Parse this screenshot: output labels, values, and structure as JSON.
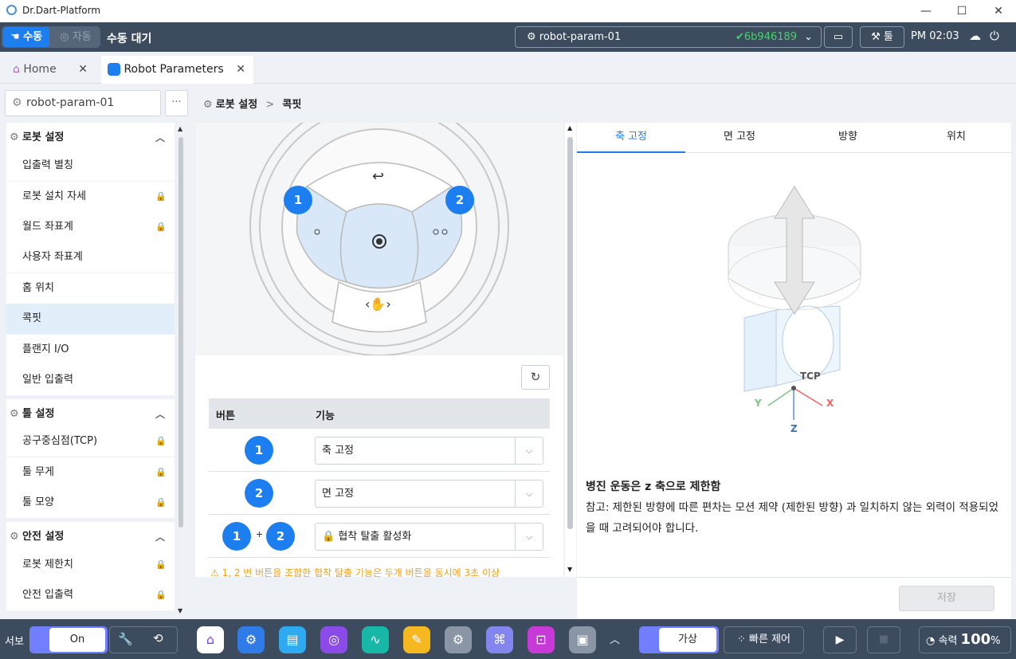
{
  "window": {
    "title": "Dr.Dart-Platform",
    "minimize": "—",
    "maximize": "☐",
    "close": "✕"
  },
  "header": {
    "mode_manual": "수동",
    "mode_auto": "자동",
    "status": "수동 대기",
    "robot_selector": "robot-param-01",
    "commit": "6b946189",
    "tool_label": "툴",
    "clock": "PM 02:03"
  },
  "tabs": [
    {
      "label": "Home",
      "close": "✕"
    },
    {
      "label": "Robot Parameters",
      "close": "✕"
    }
  ],
  "sidebar": {
    "robot_name": "robot-param-01",
    "more": "···",
    "sections": [
      {
        "title": "로봇 설정",
        "items": [
          "입출력 별칭",
          "로봇 설치 자세",
          "월드 좌표계",
          "사용자 좌표계",
          "홈 위치",
          "콕핏",
          "플랜지 I/O",
          "일반 입출력"
        ]
      },
      {
        "title": "툴 설정",
        "items": [
          "공구중심점(TCP)",
          "툴 무게",
          "툴 모양"
        ]
      },
      {
        "title": "안전 설정",
        "items": [
          "로봇 제한치",
          "안전 입출력"
        ]
      }
    ]
  },
  "breadcrumb": {
    "parent": "로봇 설정",
    "sep": ">",
    "current": "콕핏"
  },
  "table": {
    "col_button": "버튼",
    "col_function": "기능",
    "rows": [
      {
        "b1": "1",
        "value": "축 고정"
      },
      {
        "b1": "2",
        "value": "면 고정"
      },
      {
        "b1": "1",
        "plus": "+",
        "b2": "2",
        "value": "협착 탈출 활성화"
      }
    ],
    "warning": "1, 2 번 버튼을 조합한 협착 탈출 기능은 두개 버튼을 동시에 3초 이상"
  },
  "cockpit": {
    "badge1": "1",
    "badge2": "2"
  },
  "right_tabs": [
    "축 고정",
    "면 고정",
    "방향",
    "위치"
  ],
  "diagram": {
    "tcp": "TCP",
    "x": "X",
    "y": "Y",
    "z": "Z"
  },
  "description": {
    "title": "병진 운동은 z 축으로 제한함",
    "note": "참고: 제한된 방향에 따른 편차는 모션 제약 (제한된 방향) 과 일치하지 않는 외력이 적용되었을 때 고려되어야 합니다."
  },
  "save_label": "저장",
  "taskbar": {
    "servo": "서보",
    "on": "On",
    "virtual": "가상",
    "quick_control": "빠른 제어",
    "speed_label": "속력",
    "speed": "100",
    "speed_unit": "%"
  },
  "colors": {
    "header": "#3d4b5e",
    "accent": "#1d7ef0",
    "commit_green": "#44d36b",
    "warning": "#f0a020"
  }
}
